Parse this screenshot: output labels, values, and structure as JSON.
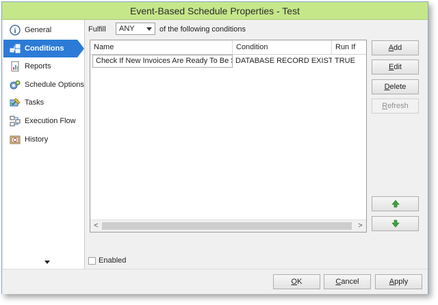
{
  "window": {
    "title": "Event-Based Schedule Properties - Test"
  },
  "sidebar": {
    "items": [
      {
        "label": "General",
        "icon": "info-icon"
      },
      {
        "label": "Conditions",
        "icon": "conditions-icon",
        "active": true
      },
      {
        "label": "Reports",
        "icon": "reports-icon"
      },
      {
        "label": "Schedule Options",
        "icon": "schedule-options-icon"
      },
      {
        "label": "Tasks",
        "icon": "tasks-icon"
      },
      {
        "label": "Execution Flow",
        "icon": "execution-flow-icon"
      },
      {
        "label": "History",
        "icon": "history-icon"
      }
    ],
    "scroll_icon": "chevron-down-icon"
  },
  "conditions": {
    "fulfill_label": "Fulfill",
    "fulfill_value": "ANY",
    "fulfill_tail": "of the following conditions",
    "columns": [
      "Name",
      "Condition",
      "Run If"
    ],
    "rows": [
      {
        "name": "Check If New Invoices Are Ready To Be Sent",
        "condition": "DATABASE RECORD EXISTS",
        "run_if": "TRUE"
      }
    ],
    "scroll_left": "<",
    "scroll_right": ">",
    "enabled_label": "Enabled",
    "enabled_checked": false
  },
  "actions": {
    "add": {
      "mnemonic": "A",
      "rest": "dd"
    },
    "edit": {
      "mnemonic": "E",
      "rest": "dit"
    },
    "delete": {
      "mnemonic": "D",
      "rest": "elete"
    },
    "refresh": {
      "mnemonic": "R",
      "rest": "efresh",
      "disabled": true
    },
    "move_up_icon": "arrow-up-icon",
    "move_down_icon": "arrow-down-icon"
  },
  "footer": {
    "ok": {
      "mnemonic": "O",
      "rest": "K"
    },
    "cancel": {
      "mnemonic": "C",
      "rest": "ancel"
    },
    "apply": {
      "mnemonic": "A",
      "rest": "pply"
    }
  },
  "colors": {
    "titlebar": "#c5e78a",
    "active_nav": "#2b7bd6",
    "arrow_green": "#3aa53a"
  }
}
